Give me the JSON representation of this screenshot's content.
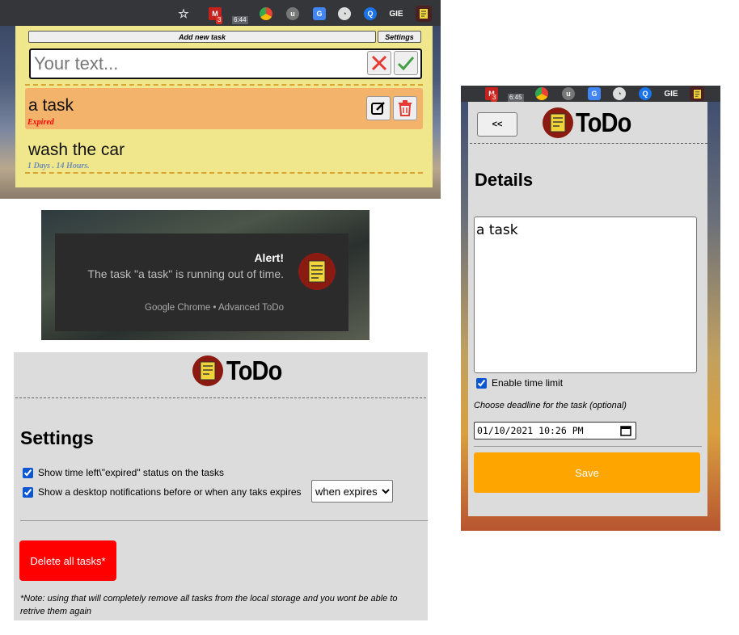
{
  "colors": {
    "popup_yellow": "#f0e68c",
    "task_expired": "#f4b36b",
    "expired_red": "#ff0000",
    "time_left_blue": "#6f8fb5",
    "delete_red": "#ff0000",
    "save_orange": "#ffa500",
    "panel_gray": "#dcdcdc"
  },
  "popup": {
    "toolbar": {
      "clock1": "6:44",
      "badge1": "3",
      "ext_label": "GIE"
    },
    "add_button": "Add new task",
    "settings_button": "Settings",
    "input_placeholder": "Your text...",
    "cancel_icon": "close-icon",
    "confirm_icon": "check-icon",
    "tasks": [
      {
        "title": "a task",
        "status": "Expired",
        "edit_icon": "edit-icon",
        "delete_icon": "trash-icon"
      },
      {
        "title": "wash the car",
        "status": "1 Days . 14 Hours."
      }
    ]
  },
  "notification": {
    "title": "Alert!",
    "body": "The task \"a task\" is running out of time.",
    "source": "Google Chrome • Advanced ToDo"
  },
  "settings": {
    "logo_text": "ToDo",
    "heading": "Settings",
    "option1": "Show time left\\\"expired\" status on the tasks",
    "option2": "Show a desktop notifications before or when any taks expires",
    "notify_select": "when expires",
    "delete_button": "Delete all tasks*",
    "note": "*Note: using that will completely remove all tasks from the local storage and you wont be able to retrive them again"
  },
  "details": {
    "toolbar": {
      "clock2": "6:45",
      "badge2": "3",
      "ext_label": "GIE"
    },
    "back_button": "<<",
    "logo_text": "ToDo",
    "heading": "Details",
    "task_text": "a task",
    "enable_time_limit": "Enable time limit",
    "deadline_label": "Choose deadline for the task (optional)",
    "deadline_value": "01/10/2021 10:26 PM",
    "save_button": "Save"
  }
}
